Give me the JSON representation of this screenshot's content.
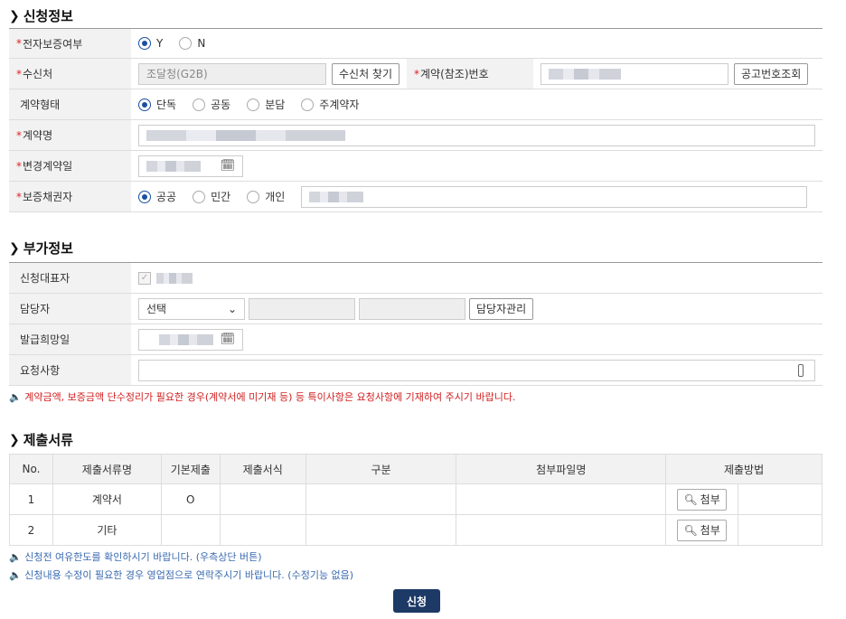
{
  "sections": {
    "apply": "신청정보",
    "extra": "부가정보",
    "docs": "제출서류"
  },
  "apply": {
    "e_guarantee": {
      "label": "전자보증여부",
      "options": [
        "Y",
        "N"
      ],
      "selected": "Y"
    },
    "recipient": {
      "label": "수신처",
      "value": "조달청(G2B)",
      "find_button": "수신처 찾기"
    },
    "contract_no": {
      "label": "계약(참조)번호",
      "lookup_button": "공고번호조회"
    },
    "contract_type": {
      "label": "계약형태",
      "options": [
        "단독",
        "공동",
        "분담",
        "주계약자"
      ],
      "selected": "단독"
    },
    "contract_name": {
      "label": "계약명"
    },
    "change_date": {
      "label": "변경계약일"
    },
    "creditor": {
      "label": "보증채권자",
      "options": [
        "공공",
        "민간",
        "개인"
      ],
      "selected": "공공"
    }
  },
  "extra": {
    "representative": {
      "label": "신청대표자"
    },
    "manager": {
      "label": "담당자",
      "select_value": "선택",
      "manage_button": "담당자관리"
    },
    "issue_date": {
      "label": "발급희망일"
    },
    "request": {
      "label": "요청사항"
    },
    "notice": "계약금액, 보증금액 단수정리가 필요한 경우(계약서에 미기재 등) 등 특이사항은 요청사항에 기재하여 주시기 바랍니다."
  },
  "docs": {
    "columns": [
      "No.",
      "제출서류명",
      "기본제출",
      "제출서식",
      "구분",
      "첨부파일명",
      "제출방법"
    ],
    "rows": [
      {
        "no": "1",
        "name": "계약서",
        "basic": "O",
        "attach": "첨부"
      },
      {
        "no": "2",
        "name": "기타",
        "basic": "",
        "attach": "첨부"
      }
    ],
    "notice1": "신청전 여유한도를 확인하시기 바랍니다. (우측상단 버튼)",
    "notice2": "신청내용 수정이 필요한 경우 영업점으로 연락주시기 바랍니다. (수정기능 없음)"
  },
  "submit_label": "신청",
  "icons": {
    "notice": "speaker-icon",
    "calendar": "calendar-icon",
    "search": "search-icon"
  },
  "colors": {
    "required": "#e02020",
    "submit": "#1d3a66",
    "radio": "#1a4fa0"
  }
}
